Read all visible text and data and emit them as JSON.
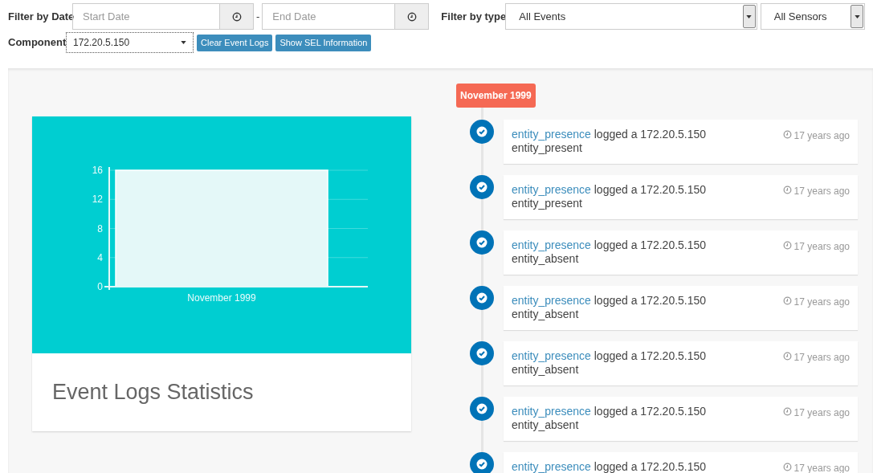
{
  "filters": {
    "date_label": "Filter by Date",
    "start_placeholder": "Start Date",
    "separator": "-",
    "end_placeholder": "End Date",
    "type_label": "Filter by type",
    "event_type": "All Events",
    "sensor": "All Sensors",
    "component_label": "Component",
    "component": "172.20.5.150",
    "buttons": [
      "Clear Event Logs",
      "Show SEL Information"
    ]
  },
  "stats_card": {
    "title": "Event Logs Statistics",
    "chart_data": {
      "type": "bar",
      "categories": [
        "November 1999"
      ],
      "values": [
        16
      ],
      "ylim": [
        0,
        16
      ],
      "grid": true,
      "yticks": [
        0,
        4,
        8,
        12,
        16
      ]
    }
  },
  "timeline": {
    "month": "November 1999",
    "events": [
      {
        "source": "entity_presence",
        "message": "logged a 172.20.5.150",
        "detail": "entity_present",
        "time": "17 years ago"
      },
      {
        "source": "entity_presence",
        "message": "logged a 172.20.5.150",
        "detail": "entity_present",
        "time": "17 years ago"
      },
      {
        "source": "entity_presence",
        "message": "logged a 172.20.5.150",
        "detail": "entity_absent",
        "time": "17 years ago"
      },
      {
        "source": "entity_presence",
        "message": "logged a 172.20.5.150",
        "detail": "entity_absent",
        "time": "17 years ago"
      },
      {
        "source": "entity_presence",
        "message": "logged a 172.20.5.150",
        "detail": "entity_absent",
        "time": "17 years ago"
      },
      {
        "source": "entity_presence",
        "message": "logged a 172.20.5.150",
        "detail": "entity_absent",
        "time": "17 years ago"
      },
      {
        "source": "entity_presence",
        "message": "logged a 172.20.5.150",
        "time": "17 years ago"
      }
    ]
  }
}
